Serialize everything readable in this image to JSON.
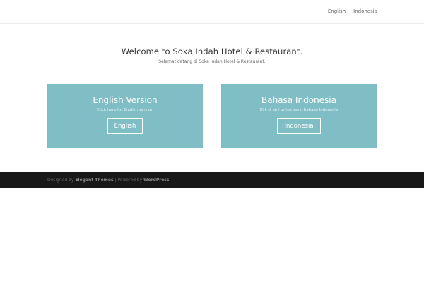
{
  "nav": {
    "items": [
      "English",
      "Indonesia"
    ]
  },
  "welcome": {
    "title": "Welcome to Soka Indah Hotel & Restaurant.",
    "subtitle": "Selamat datang di Soka Indah Hotel & Restaurant."
  },
  "cards": [
    {
      "title": "English Version",
      "text": "Click here for English version",
      "button": "English"
    },
    {
      "title": "Bahasa Indonesia",
      "text": "Klik di sini untuk versi bahasa Indonesia",
      "button": "Indonesia"
    }
  ],
  "footer": {
    "designed_by": "Designed by",
    "elegant": "Elegant Themes",
    "separator": "| Powered by",
    "wordpress": "WordPress"
  },
  "colors": {
    "card_bg": "#80bec5",
    "footer_bg": "#181818"
  }
}
